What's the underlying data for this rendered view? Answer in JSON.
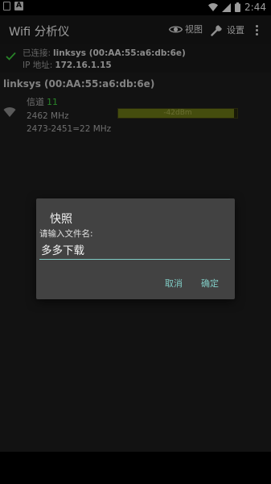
{
  "status_bar": {
    "time": "2:44",
    "icons": [
      "notification-box-icon",
      "notification-a-icon",
      "wifi-status-icon",
      "signal-icon",
      "battery-icon"
    ]
  },
  "app_bar": {
    "title": "Wifi 分析仪",
    "view_label": "视图",
    "settings_label": "设置"
  },
  "connection": {
    "connected_label": "已连接:",
    "connected_value": "linksys (00:AA:55:a6:db:6e)",
    "ip_label": "IP 地址:",
    "ip_value": "172.16.1.15"
  },
  "networks": [
    {
      "title": "linksys (00:AA:55:a6:db:6e)",
      "channel_label": "信道",
      "channel": "11",
      "frequency": "2462 MHz",
      "range": "2473-2451=22 MHz",
      "signal_text": "-42dBm",
      "signal_level": 0.97
    }
  ],
  "dialog": {
    "title": "快照",
    "prompt": "请输入文件名:",
    "input_value": "多多下载",
    "cancel_label": "取消",
    "ok_label": "确定"
  },
  "colors": {
    "accent": "#80cbc4",
    "channel_green": "#3ec93e",
    "signal_bar": "#6b7716",
    "dialog_bg": "#424242"
  }
}
